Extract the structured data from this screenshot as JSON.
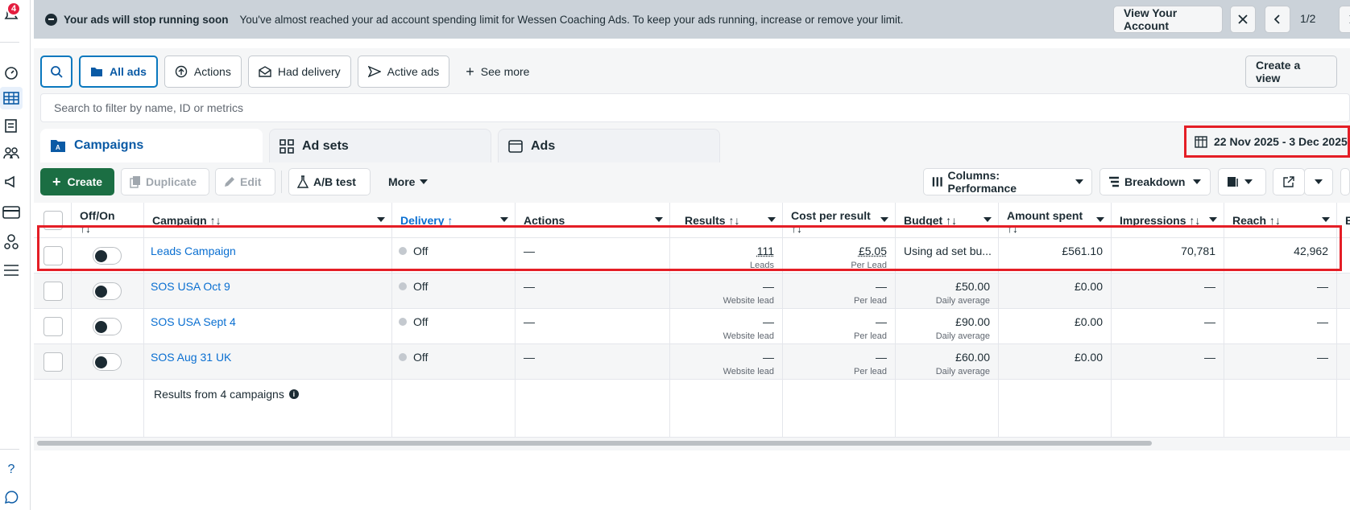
{
  "notifications": {
    "count": "4"
  },
  "banner": {
    "title": "Your ads will stop running soon",
    "message": "You've almost reached your ad account spending limit for Wessen Coaching Ads. To keep your ads running, increase or remove your limit.",
    "view_account": "View Your Account",
    "pager": "1/2"
  },
  "filters": {
    "all_ads": "All ads",
    "actions": "Actions",
    "had_delivery": "Had delivery",
    "active_ads": "Active ads",
    "see_more": "See more",
    "create_view": "Create a view",
    "search_placeholder": "Search to filter by name, ID or metrics"
  },
  "level_tabs": {
    "campaigns": "Campaigns",
    "ad_sets": "Ad sets",
    "ads": "Ads"
  },
  "date_range": "22 Nov 2025 - 3 Dec 2025",
  "toolbar": {
    "create": "Create",
    "duplicate": "Duplicate",
    "edit": "Edit",
    "ab_test": "A/B test",
    "more": "More",
    "columns": "Columns: Performance",
    "breakdown": "Breakdown"
  },
  "columns": {
    "off_on": "Off/On",
    "sort": "↑↓",
    "campaign": "Campaign ↑↓",
    "delivery": "Delivery ↑",
    "actions": "Actions",
    "results": "Results ↑↓",
    "cost_per_result": "Cost per result",
    "budget": "Budget ↑↓",
    "amount_spent": "Amount spent",
    "impressions": "Impressions ↑↓",
    "reach": "Reach ↑↓",
    "next": "E"
  },
  "rows": [
    {
      "name": "Leads Campaign",
      "delivery": "Off",
      "actions": "—",
      "results": "111",
      "results_sub": "Leads",
      "cpr": "£5.05",
      "cpr_sub": "Per Lead",
      "budget": "Using ad set bu...",
      "budget_sub": "",
      "spent": "£561.10",
      "impressions": "70,781",
      "reach": "42,962"
    },
    {
      "name": "SOS USA Oct 9",
      "delivery": "Off",
      "actions": "—",
      "results": "—",
      "results_sub": "Website lead",
      "cpr": "—",
      "cpr_sub": "Per lead",
      "budget": "£50.00",
      "budget_sub": "Daily average",
      "spent": "£0.00",
      "impressions": "—",
      "reach": "—"
    },
    {
      "name": "SOS USA Sept 4",
      "delivery": "Off",
      "actions": "—",
      "results": "—",
      "results_sub": "Website lead",
      "cpr": "—",
      "cpr_sub": "Per lead",
      "budget": "£90.00",
      "budget_sub": "Daily average",
      "spent": "£0.00",
      "impressions": "—",
      "reach": "—"
    },
    {
      "name": "SOS Aug 31 UK",
      "delivery": "Off",
      "actions": "—",
      "results": "—",
      "results_sub": "Website lead",
      "cpr": "—",
      "cpr_sub": "Per lead",
      "budget": "£60.00",
      "budget_sub": "Daily average",
      "spent": "£0.00",
      "impressions": "—",
      "reach": "—"
    }
  ],
  "summary": "Results from 4 campaigns",
  "colors": {
    "accent": "#0a78be",
    "create": "#1b6e43",
    "highlight": "#e41e26"
  }
}
